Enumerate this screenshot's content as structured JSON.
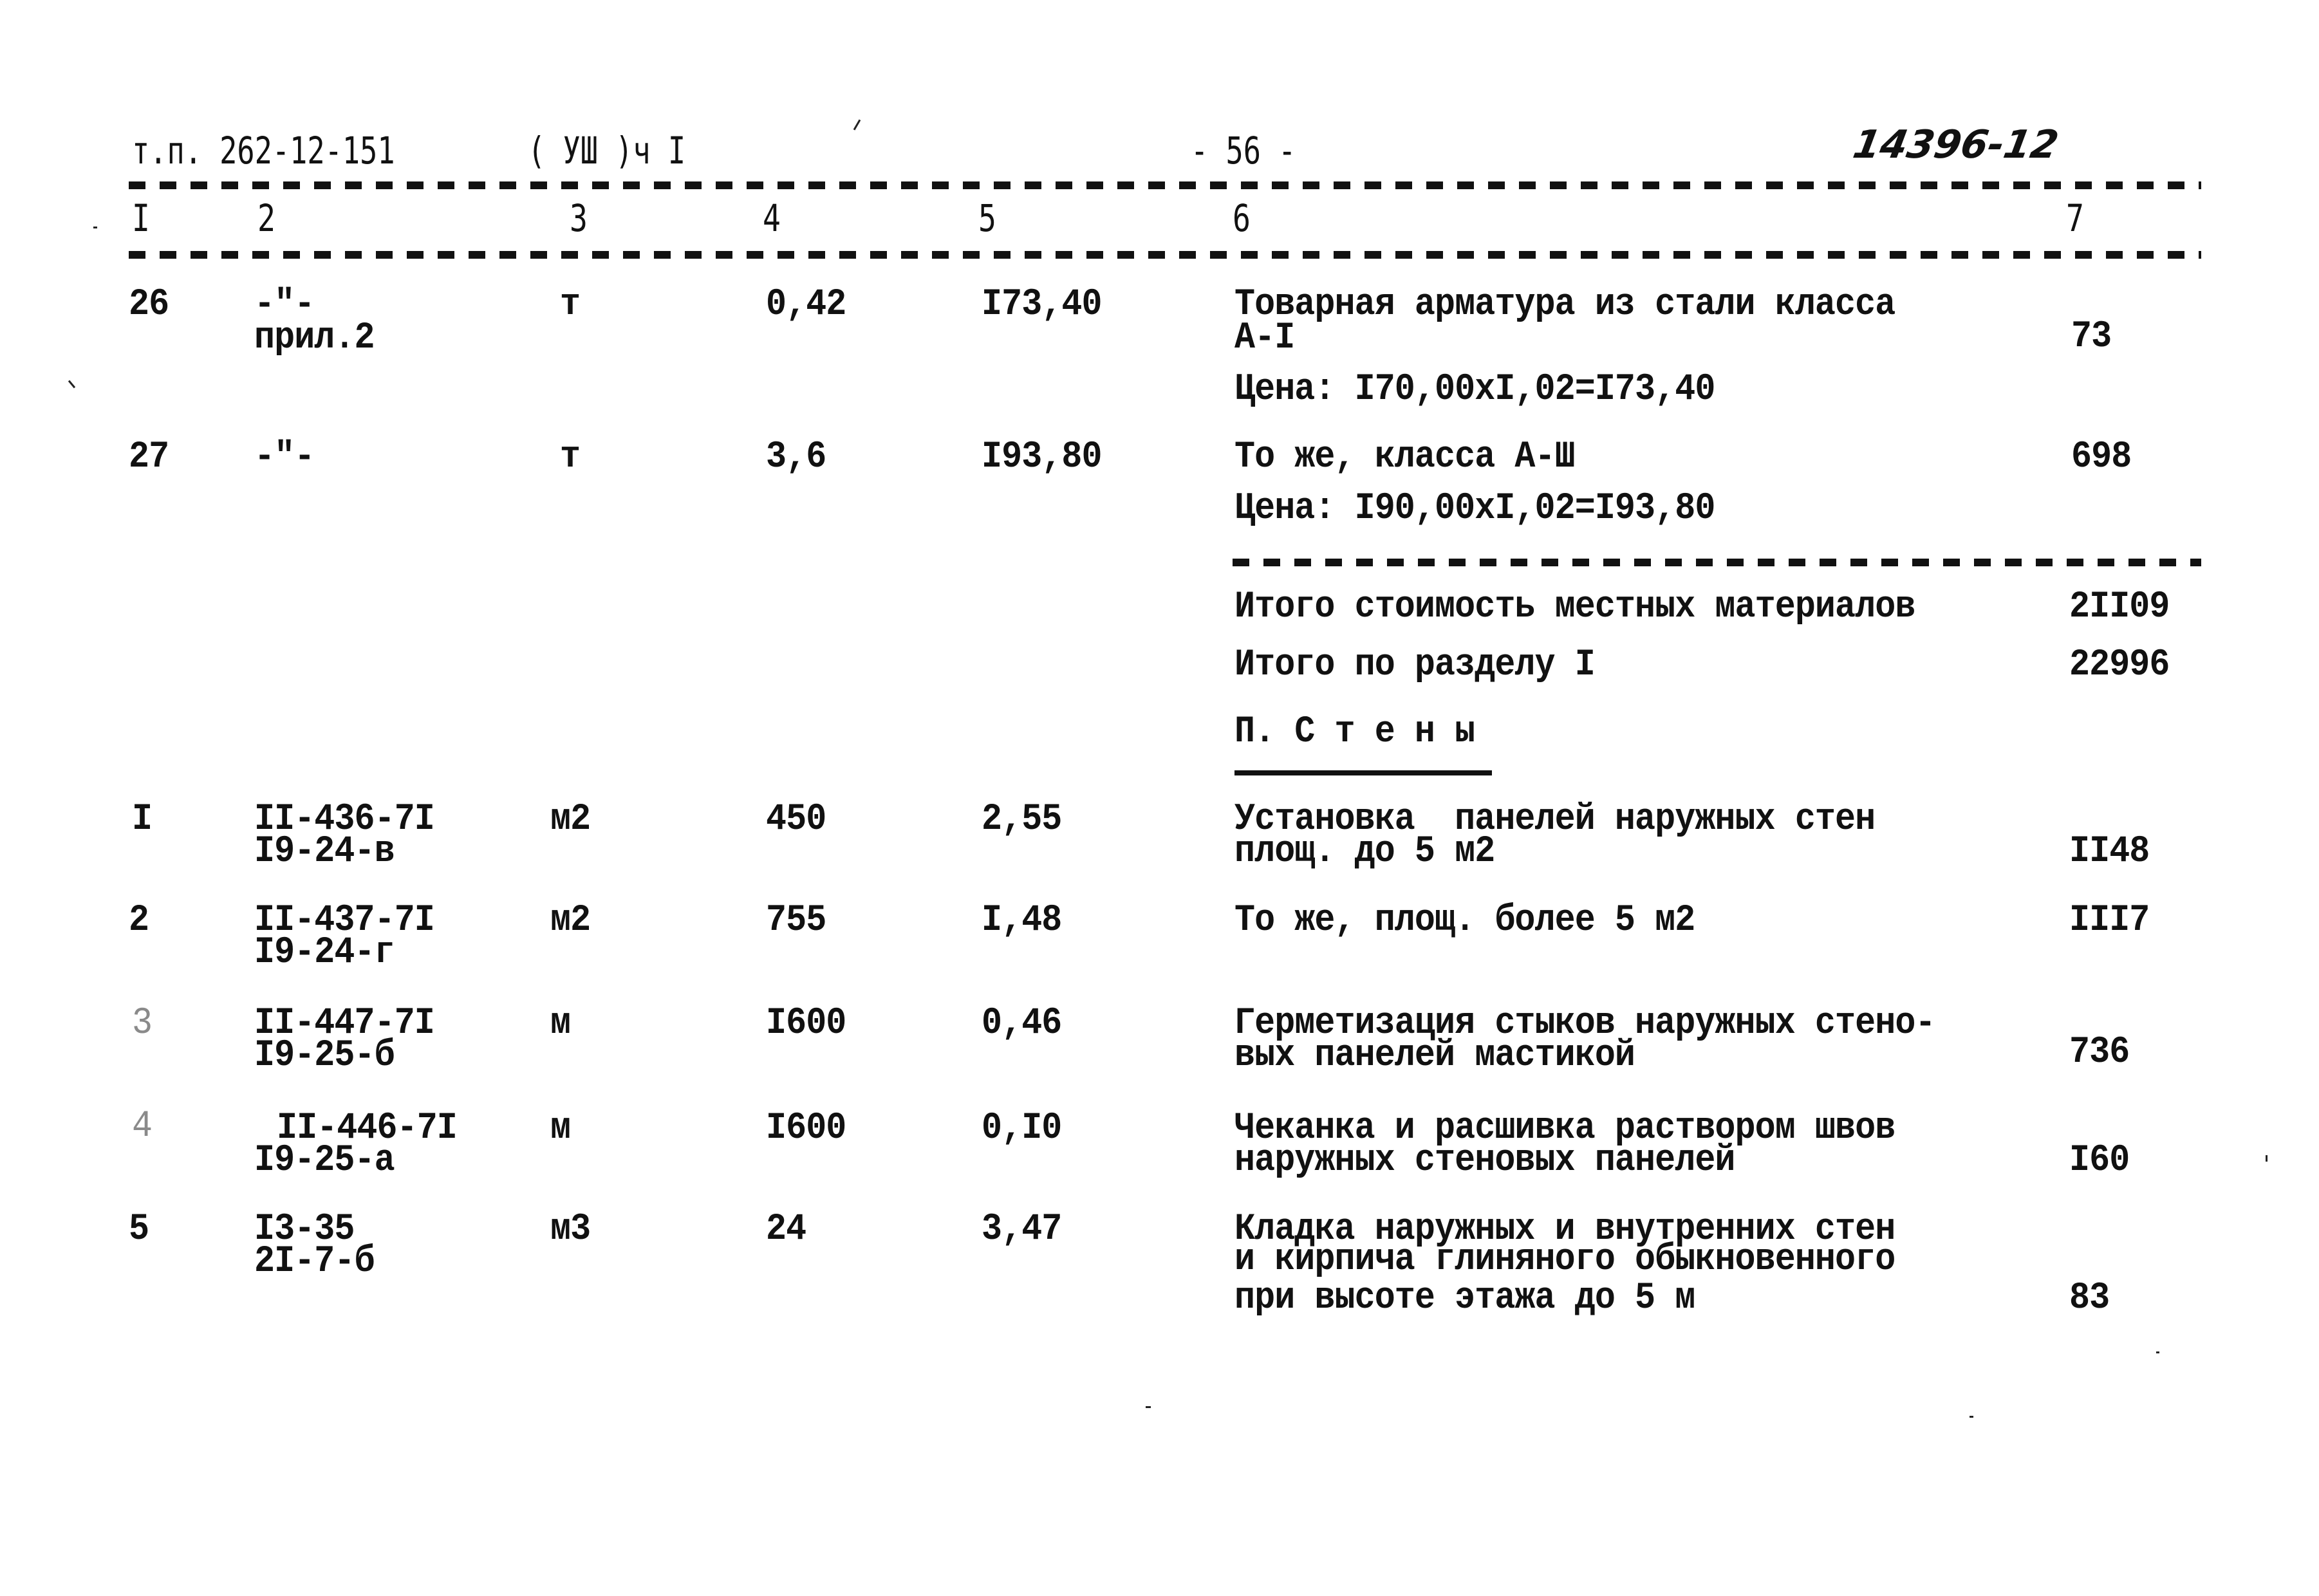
{
  "header": {
    "doc_code": "т.п. 262-12-151",
    "section": "( УШ )ч I",
    "page": "- 56 -",
    "handwritten_number": "14396-12"
  },
  "columns": [
    "I",
    "2",
    "3",
    "4",
    "5",
    "6",
    "7"
  ],
  "rows_top": [
    {
      "num": "26",
      "code": [
        "-\"-",
        "прил.2"
      ],
      "unit": "т",
      "qty": "0,42",
      "price": "I73,40",
      "desc": [
        "Товарная арматура из стали класса",
        "А-I"
      ],
      "price_note": "Цена: I70,00хI,02=I73,40",
      "total": "73"
    },
    {
      "num": "27",
      "code": [
        "-\"-"
      ],
      "unit": "т",
      "qty": "3,6",
      "price": "I93,80",
      "desc": [
        "То же, класса А-Ш"
      ],
      "price_note": "Цена: I90,00хI,02=I93,80",
      "total": "698"
    }
  ],
  "subtotals": [
    {
      "label": "Итого стоимость местных материалов",
      "value": "2II09"
    },
    {
      "label": "Итого по разделу I",
      "value": "22996"
    }
  ],
  "section_title": "П. С т е н ы",
  "rows_bottom": [
    {
      "num": "I",
      "code": [
        "II-436-7I",
        "I9-24-в"
      ],
      "unit": "м2",
      "qty": "450",
      "price": "2,55",
      "desc": [
        "Установка  панелей наружных стен",
        "площ. до 5 м2"
      ],
      "total": "II48"
    },
    {
      "num": "2",
      "code": [
        "II-437-7I",
        "I9-24-г"
      ],
      "unit": "м2",
      "qty": "755",
      "price": "I,48",
      "desc": [
        "То же, площ. более 5 м2"
      ],
      "total": "III7"
    },
    {
      "num": "3",
      "code": [
        "II-447-7I",
        "I9-25-б"
      ],
      "unit": "м",
      "qty": "I600",
      "price": "0,46",
      "desc": [
        "Герметизация стыков наружных стено-",
        "вых панелей мастикой"
      ],
      "total": "736"
    },
    {
      "num": "4",
      "code": [
        "II-446-7I",
        "I9-25-а"
      ],
      "unit": "м",
      "qty": "I600",
      "price": "0,I0",
      "desc": [
        "Чеканка и расшивка раствором швов",
        "наружных стеновых панелей"
      ],
      "total": "I60"
    },
    {
      "num": "5",
      "code": [
        "I3-35",
        "2I-7-б"
      ],
      "unit": "м3",
      "qty": "24",
      "price": "3,47",
      "desc": [
        "Кладка наружных и внутренних стен",
        "и кирпича глиняного обыкновенного",
        "при высоте этажа до 5 м"
      ],
      "total": "83"
    }
  ]
}
